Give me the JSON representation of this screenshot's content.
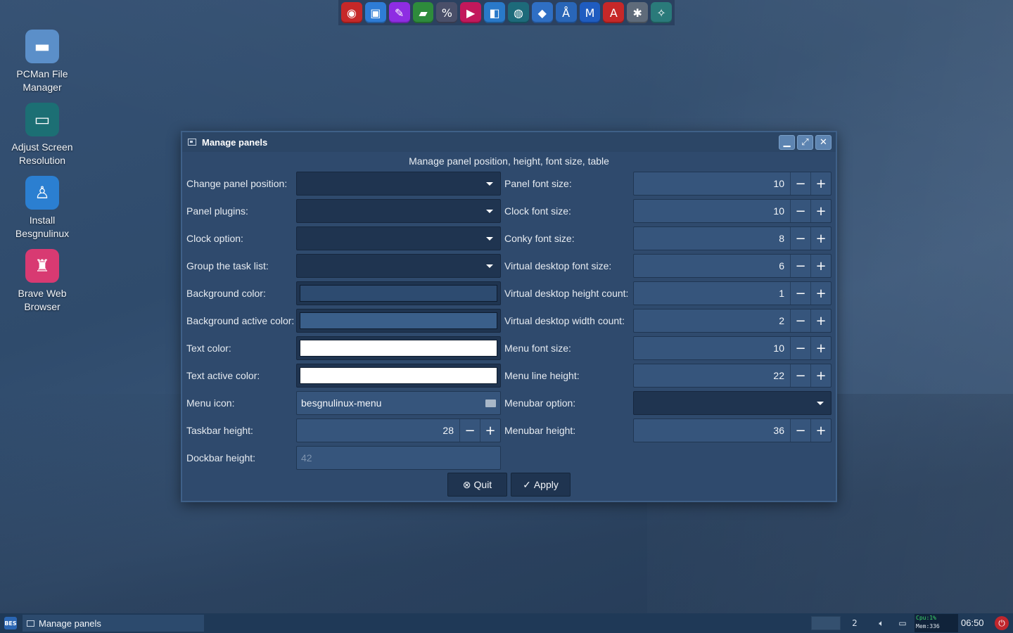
{
  "dock": {
    "items": [
      {
        "name": "lifebuoy-app-icon",
        "glyph": "◉",
        "color": "#c62828"
      },
      {
        "name": "screen-capture-app-icon",
        "glyph": "▣",
        "color": "#2e7cd6"
      },
      {
        "name": "text-editor-app-icon",
        "glyph": "✎",
        "color": "#8e2de2"
      },
      {
        "name": "notes-app-icon",
        "glyph": "▰",
        "color": "#2e8b3c"
      },
      {
        "name": "percent-app-icon",
        "glyph": "%",
        "color": "#4a4f69"
      },
      {
        "name": "media-player-app-icon",
        "glyph": "▶",
        "color": "#c2185b"
      },
      {
        "name": "document-viewer-app-icon",
        "glyph": "◧",
        "color": "#2979c9"
      },
      {
        "name": "web-browser-app-icon",
        "glyph": "◍",
        "color": "#1d6a7a"
      },
      {
        "name": "store-bag-app-icon",
        "glyph": "◆",
        "color": "#2f6fc4"
      },
      {
        "name": "installer-app-icon",
        "glyph": "Å",
        "color": "#2966b8"
      },
      {
        "name": "music-app-icon",
        "glyph": "M",
        "color": "#1f5cc0"
      },
      {
        "name": "font-app-icon",
        "glyph": "A",
        "color": "#c62828"
      },
      {
        "name": "settings-gears-app-icon",
        "glyph": "✱",
        "color": "#5f6b7a"
      },
      {
        "name": "cleaner-broom-app-icon",
        "glyph": "✧",
        "color": "#2a7a7a"
      }
    ]
  },
  "desktop_icons": [
    {
      "label": "PCMan File Manager",
      "glyph": "▬",
      "color": "#5b8fc9",
      "name": "desktop-icon-pcman-file-manager"
    },
    {
      "label": "Adjust Screen Resolution",
      "glyph": "▭",
      "color": "#1c6f74",
      "name": "desktop-icon-adjust-screen-resolution"
    },
    {
      "label": "Install Besgnulinux",
      "glyph": "♙",
      "color": "#2b7fd1",
      "name": "desktop-icon-install-besgnulinux"
    },
    {
      "label": "Brave Web Browser",
      "glyph": "♜",
      "color": "#d83a72",
      "name": "desktop-icon-brave-web-browser"
    }
  ],
  "window": {
    "title": "Manage panels",
    "subtitle": "Manage panel position, height, font size, table",
    "left_fields": {
      "panel_position": {
        "label": "Change panel position:",
        "type": "combo",
        "value": ""
      },
      "panel_plugins": {
        "label": "Panel plugins:",
        "type": "combo",
        "value": ""
      },
      "clock_option": {
        "label": "Clock option:",
        "type": "combo",
        "value": ""
      },
      "group_task_list": {
        "label": "Group the task list:",
        "type": "combo",
        "value": ""
      },
      "background_color": {
        "label": "Background color:",
        "type": "color",
        "value": "#2d4b70"
      },
      "background_active_color": {
        "label": "Background active color:",
        "type": "color",
        "value": "#3a5f8a"
      },
      "text_color": {
        "label": "Text color:",
        "type": "color",
        "value": "#ffffff"
      },
      "text_active_color": {
        "label": "Text active color:",
        "type": "color",
        "value": "#ffffff"
      },
      "menu_icon": {
        "label": "Menu icon:",
        "type": "file",
        "value": "besgnulinux-menu"
      },
      "taskbar_height": {
        "label": "Taskbar height:",
        "type": "spin",
        "value": "28"
      },
      "dockbar_height": {
        "label": "Dockbar height:",
        "type": "disabled",
        "value": "42"
      }
    },
    "right_fields": {
      "panel_font_size": {
        "label": "Panel font size:",
        "value": "10"
      },
      "clock_font_size": {
        "label": "Clock font size:",
        "value": "10"
      },
      "conky_font_size": {
        "label": "Conky font size:",
        "value": "8"
      },
      "vd_font_size": {
        "label": "Virtual desktop font size:",
        "value": "6"
      },
      "vd_height_count": {
        "label": "Virtual desktop height count:",
        "value": "1"
      },
      "vd_width_count": {
        "label": "Virtual desktop width count:",
        "value": "2"
      },
      "menu_font_size": {
        "label": "Menu font size:",
        "value": "10"
      },
      "menu_line_height": {
        "label": "Menu line height:",
        "value": "22"
      },
      "menubar_option": {
        "label": "Menubar option:",
        "value": ""
      },
      "menubar_height": {
        "label": "Menubar height:",
        "value": "36"
      }
    },
    "buttons": {
      "quit_label": "Quit",
      "apply_label": "Apply"
    }
  },
  "taskbar": {
    "start_label": "BES",
    "task_label": "Manage panels",
    "workspace_number": "2",
    "cpu_text": "Cpu:1%",
    "mem_text": "Mem:336",
    "clock": "06:50"
  }
}
